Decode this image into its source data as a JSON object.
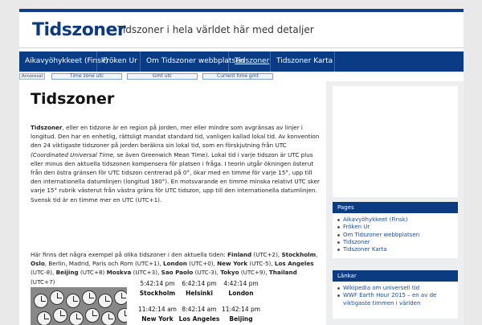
{
  "header": {
    "site_title": "Tidszoner",
    "tagline": "Tidszoner i hela världet här med detaljer"
  },
  "nav": {
    "items": [
      {
        "label": "Aikavyöhykkeet (Finsk)"
      },
      {
        "label": "Fröken Ur"
      },
      {
        "label": "Om Tidszoner webbplatsen"
      },
      {
        "label": "Tidszoner"
      },
      {
        "label": "Tidszoner Karta"
      }
    ],
    "active": "Tidszoner"
  },
  "adbar": {
    "adchoices": "Annonsval",
    "links": [
      "Time zone utc",
      "Gmt utc",
      "Current time gmt"
    ]
  },
  "main": {
    "title": "Tidszoner",
    "intro_bold": "Tidszoner",
    "intro_rest": ", eller en tidzone är en region på jorden, mer eller mindre som avgränsas av linjer i longitud. Den har en enhetlig, rättsligt mandat standard tid, vanligen kallad lokal tid. Av konvention den 24 viktigaste tidszoner på jorden beräkna sin lokal tid, som en förskjutning från UTC ",
    "intro_italic": "(Coordinated Universal Time,",
    "intro_end": " se även Greenwich Mean Time). Lokal tid i varje tidszon är UTC plus eller minus den aktuella tidszonen kompensera för platsen i fråga. I teorin utgår ökningen österut från den östra gränsen för UTC tidszon centrerad på 0°, ökar med en timme för varje 15°, upp till den internationella datumlinjen (longitud 180°). En motsvarande en timme minska relativt UTC sker varje 15° rubrik västerut från västra gräns för UTC tidszon, upp till den internationella datumlinjen. Svensk tid är en timme mer en UTC (UTC+1).",
    "examples_lead": "Här finns det några exempel på olika tidszoner i den aktuella tiden: ",
    "examples": [
      {
        "city": "Finland",
        "tz": "(UTC+2), "
      },
      {
        "city": "Stockholm",
        "tz": ", "
      },
      {
        "city": "Oslo",
        "tz": ", Berlin, Madrid, Paris och Rom (UTC+1), "
      },
      {
        "city": "London",
        "tz": " (UTC+0), "
      },
      {
        "city": "New York",
        "tz": " (UTC-5), "
      },
      {
        "city": "Los Angeles",
        "tz": " (UTC-8), "
      },
      {
        "city": "Beijing",
        "tz": " (UTC+8) "
      },
      {
        "city": "Moskva",
        "tz": " (UTC+3), "
      },
      {
        "city": "Sao Paolo",
        "tz": " (UTC-3), "
      },
      {
        "city": "Tokyo",
        "tz": " (UTC+9), "
      },
      {
        "city": "Thailand",
        "tz": " (UTC+7)"
      }
    ],
    "times": [
      {
        "time": "5:42:14 pm",
        "city": "Stockholm"
      },
      {
        "time": "6:42:14 pm",
        "city": "Helsinki"
      },
      {
        "time": "4:42:14 pm",
        "city": "London"
      },
      {
        "time": "11:42:14 am",
        "city": "New York"
      },
      {
        "time": "8:42:14 am",
        "city": "Los Angeles"
      },
      {
        "time": "11:42:14 pm",
        "city": "Beijing"
      }
    ]
  },
  "sidebar": {
    "pages": {
      "title": "Pages",
      "items": [
        "Aikavyöhykkeet (Finsk)",
        "Fröken Ur",
        "Om Tidszoner webbplatsen",
        "Tidszoner",
        "Tidszoner Karta"
      ]
    },
    "links": {
      "title": "Länkar",
      "items": [
        "Wikipedia om universell tid",
        "WWF Earth Hour 2015 – en av de viktigaste timmen i världen"
      ]
    }
  }
}
